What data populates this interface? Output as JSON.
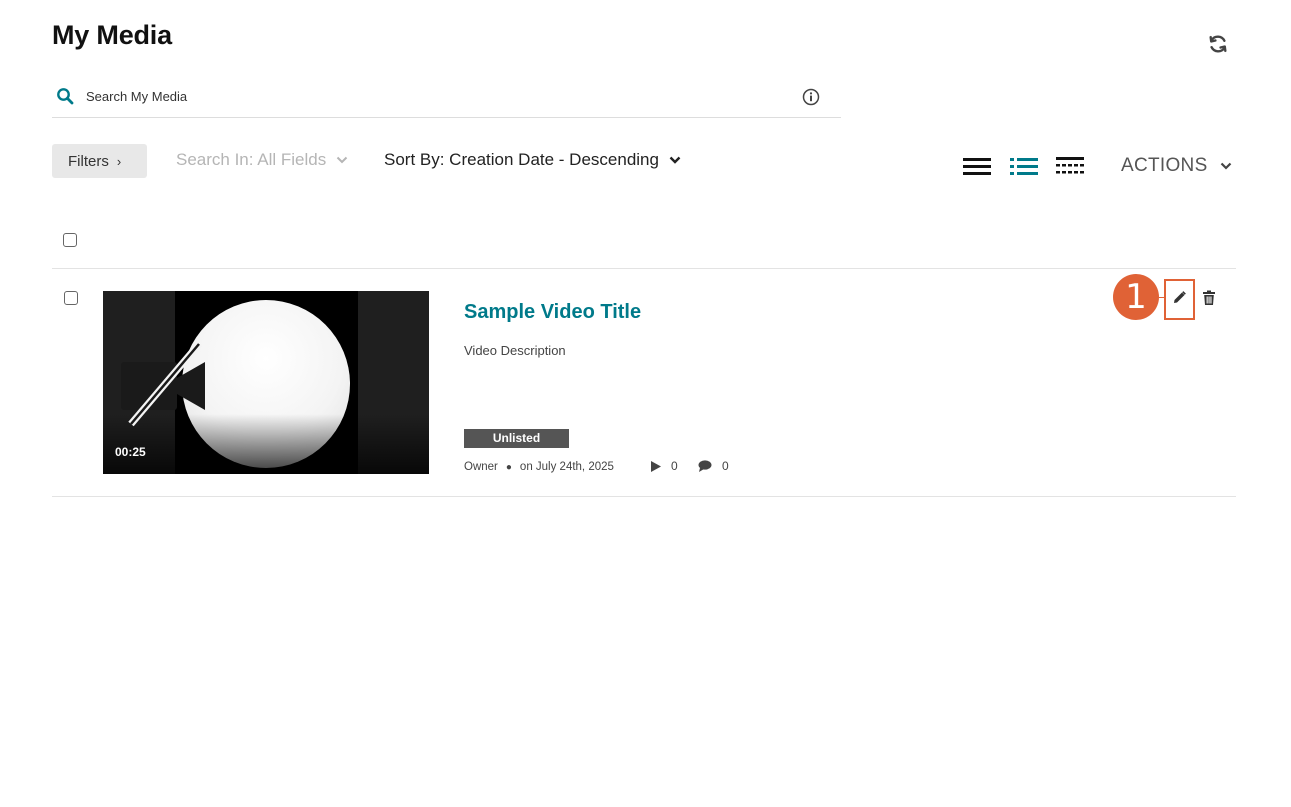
{
  "header": {
    "title": "My Media",
    "refresh_icon": "refresh-icon"
  },
  "search": {
    "placeholder": "Search My Media",
    "value": ""
  },
  "toolbar": {
    "filters_label": "Filters",
    "search_in_label": "Search In: All Fields",
    "sort_by_label": "Sort By: Creation Date - Descending",
    "actions_label": "ACTIONS",
    "views": [
      "list-view",
      "detailed-list-view",
      "compact-view"
    ],
    "active_view": "detailed-list-view",
    "accent_color": "#007a8a"
  },
  "entries": [
    {
      "title": "Sample Video Title",
      "description": "Video Description",
      "duration": "00:25",
      "status": "Unlisted",
      "owner": "Owner",
      "date": "on July 24th, 2025",
      "plays": "0",
      "comments": "0",
      "checked": false
    }
  ],
  "annotation": {
    "step_number": "1",
    "color": "#e06236"
  }
}
